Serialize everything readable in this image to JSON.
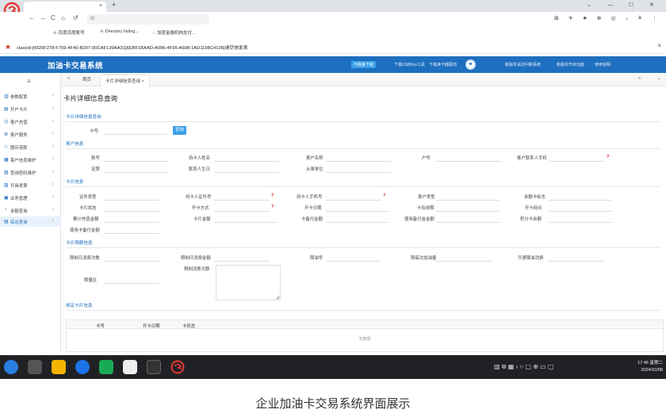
{
  "browser": {
    "tab_title": "",
    "tab_close": "×",
    "new_tab": "+",
    "window_controls": "⌄ — ☐ ✕",
    "nav": {
      "back": "←",
      "forward": "→",
      "reload": "C",
      "home": "⌂",
      "history": "↺"
    },
    "address": "",
    "toolbar_icons": "⊞ ✈ ★ ⊕ ◎ ↓ ≗ ⋮",
    "bookmarks": [
      {
        "icon": "⊕",
        "label": "百度百度账号"
      },
      {
        "icon": "⊕",
        "label": "Directory listing..."
      },
      {
        "icon": "∩",
        "label": "加密金融机构支付..."
      }
    ]
  },
  "alert": {
    "text": "classId:[4320F278-F759-4F40-B207-00CAF139AA31]/[EBF1BAAD-A096-4F95-A608-1AD1198C4106]请尽快发表",
    "close": "×"
  },
  "app": {
    "title": "加油卡交易系统",
    "header_links": [
      {
        "label": "与我来下载",
        "highlight": true
      },
      {
        "label": "下载USBKey工具",
        "highlight": false
      },
      {
        "label": "下载读卡器驱动",
        "highlight": false
      },
      {
        "label": "新版本请访问新系统",
        "highlight": false
      },
      {
        "label": "新版本开启功能",
        "highlight": false
      },
      {
        "label": "使用说明",
        "highlight": false
      }
    ]
  },
  "sidebar": {
    "toggle": "≡",
    "items": [
      {
        "icon": "▥",
        "label": "参数配置",
        "active": false
      },
      {
        "icon": "▤",
        "label": "开户卡片",
        "active": false
      },
      {
        "icon": "◷",
        "label": "客户充值",
        "active": false
      },
      {
        "icon": "⚙",
        "label": "客户服务",
        "active": false
      },
      {
        "icon": "♲",
        "label": "圈存退款",
        "active": false
      },
      {
        "icon": "▦",
        "label": "客户信息维护",
        "active": false
      },
      {
        "icon": "▧",
        "label": "查询密码维护",
        "active": false
      },
      {
        "icon": "▨",
        "label": "开具发票",
        "active": false
      },
      {
        "icon": "▣",
        "label": "业务管理",
        "active": false
      },
      {
        "icon": "◔",
        "label": "余额查询",
        "active": false
      },
      {
        "icon": "▤",
        "label": "综合查询",
        "active": true
      }
    ],
    "arrow": "›"
  },
  "pagetabs": {
    "nav_left": "«",
    "home": "首页",
    "active": "卡片详细信息查询",
    "close": "×",
    "nav_right": "»",
    "dropdown": "⌄"
  },
  "page": {
    "title": "卡片详细信息查询",
    "query_section": "卡片详细信息查询",
    "card_no_label": "卡号:",
    "query_button": "查询",
    "customer_section": "客户信息",
    "customer_fields": [
      {
        "label": "账号"
      },
      {
        "label": "持卡人姓名"
      },
      {
        "label": "客户名称"
      },
      {
        "label": "户号"
      },
      {
        "label": "客户联系人手机",
        "required": true
      },
      {
        "label": "证照"
      },
      {
        "label": "联系人生日"
      },
      {
        "label": "从事单位"
      }
    ],
    "card_section": "卡片信息",
    "card_fields": [
      {
        "label": "证件类型"
      },
      {
        "label": "持卡人证件号",
        "required": true
      },
      {
        "label": "持卡人手机号",
        "required": true
      },
      {
        "label": "客户类型"
      },
      {
        "label": "余额卡标志"
      },
      {
        "label": "卡片状态"
      },
      {
        "label": "开卡方式",
        "required": true
      },
      {
        "label": "开卡日期"
      },
      {
        "label": "卡有效期"
      },
      {
        "label": "开卡网点"
      },
      {
        "label": "累计充值金额"
      },
      {
        "label": "卡片金额"
      },
      {
        "label": "卡备付金额"
      },
      {
        "label": "使用备付金金额"
      },
      {
        "label": "积分卡余额"
      },
      {
        "label": "使用卡备付金额"
      }
    ],
    "limit_section": "卡片限额信息",
    "limit_fields": [
      {
        "label": "限制日消费次数"
      },
      {
        "label": "限制日消费金额"
      },
      {
        "label": "限油号"
      },
      {
        "label": "限每次加油量"
      },
      {
        "label": "开通限油消费"
      },
      {
        "label": "限制消费次数"
      },
      {
        "label": "限量区"
      }
    ],
    "bind_section": "绑定卡片信息",
    "grid_headers": [
      "卡号",
      "开卡日期",
      "卡状态"
    ],
    "grid_empty": "无数据"
  },
  "taskbar": {
    "tray": "▥ ⧉ ▦ › ○ ▢ ⊕ ▭ ▢",
    "time": "17:46 星期二",
    "date": "2024/10/08"
  },
  "caption": "企业加油卡交易系统界面展示"
}
